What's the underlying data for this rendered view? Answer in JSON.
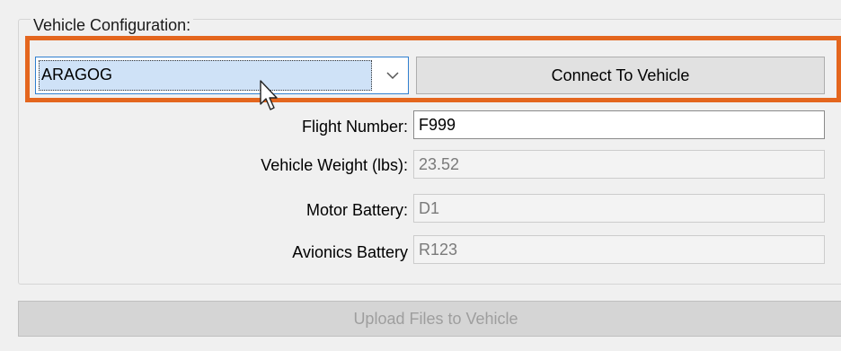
{
  "vehicle_config": {
    "legend": "Vehicle Configuration:",
    "vehicle_select": {
      "value": "ARAGOG"
    },
    "connect_label": "Connect To Vehicle",
    "fields": [
      {
        "label": "Flight Number:",
        "value": "F999",
        "editable": true
      },
      {
        "label": "Vehicle Weight (lbs):",
        "value": "23.52",
        "editable": false
      },
      {
        "label": "Motor Battery:",
        "value": "D1",
        "editable": false
      },
      {
        "label": "Avionics Battery",
        "value": "R123",
        "editable": false
      }
    ]
  },
  "upload_label": "Upload Files to Vehicle",
  "icons": {
    "dropdown": "chevron-down-icon",
    "cursor": "mouse-cursor-icon"
  },
  "colors": {
    "highlight": "#e4661e",
    "selection": "#cfe2f7",
    "focus_border": "#2f7fd0"
  }
}
